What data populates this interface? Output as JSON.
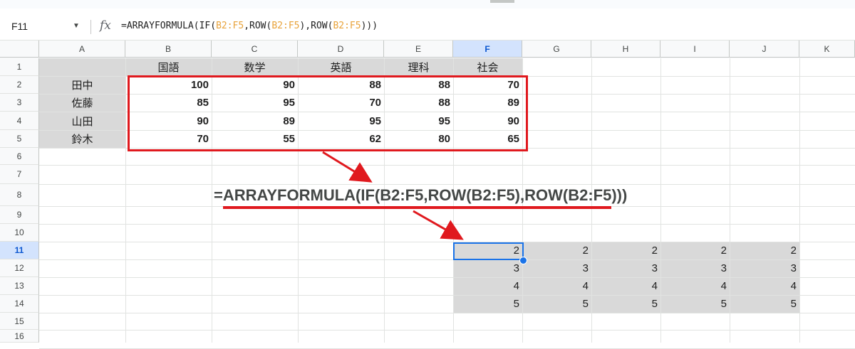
{
  "formula_bar": {
    "name_box": "F11",
    "fx_label": "fx",
    "formula_parts": [
      "=ARRAYFORMULA(IF(",
      "B2:F5",
      ",ROW(",
      "B2:F5",
      "),ROW(",
      "B2:F5",
      ")))"
    ]
  },
  "columns": [
    "A",
    "B",
    "C",
    "D",
    "E",
    "F",
    "G",
    "H",
    "I",
    "J",
    "K"
  ],
  "rows": [
    "1",
    "2",
    "3",
    "4",
    "5",
    "6",
    "7",
    "8",
    "9",
    "10",
    "11",
    "12",
    "13",
    "14",
    "15",
    "16"
  ],
  "selected_column": "F",
  "selected_row": "11",
  "header_row": [
    "国語",
    "数学",
    "英語",
    "理科",
    "社会"
  ],
  "names": [
    "田中",
    "佐藤",
    "山田",
    "鈴木"
  ],
  "scores": [
    [
      "100",
      "90",
      "88",
      "88",
      "70"
    ],
    [
      "85",
      "95",
      "70",
      "88",
      "89"
    ],
    [
      "90",
      "89",
      "95",
      "95",
      "90"
    ],
    [
      "70",
      "55",
      "62",
      "80",
      "65"
    ]
  ],
  "result": [
    [
      "2",
      "2",
      "2",
      "2",
      "2"
    ],
    [
      "3",
      "3",
      "3",
      "3",
      "3"
    ],
    [
      "4",
      "4",
      "4",
      "4",
      "4"
    ],
    [
      "5",
      "5",
      "5",
      "5",
      "5"
    ]
  ],
  "annotation_formula": "=ARRAYFORMULA(IF(B2:F5,ROW(B2:F5),ROW(B2:F5)))",
  "colors": {
    "annotation_red": "#e0191e",
    "selection_blue": "#1a73e8",
    "range_orange": "#e8a33b",
    "fill_gray": "#d9d9d9"
  }
}
